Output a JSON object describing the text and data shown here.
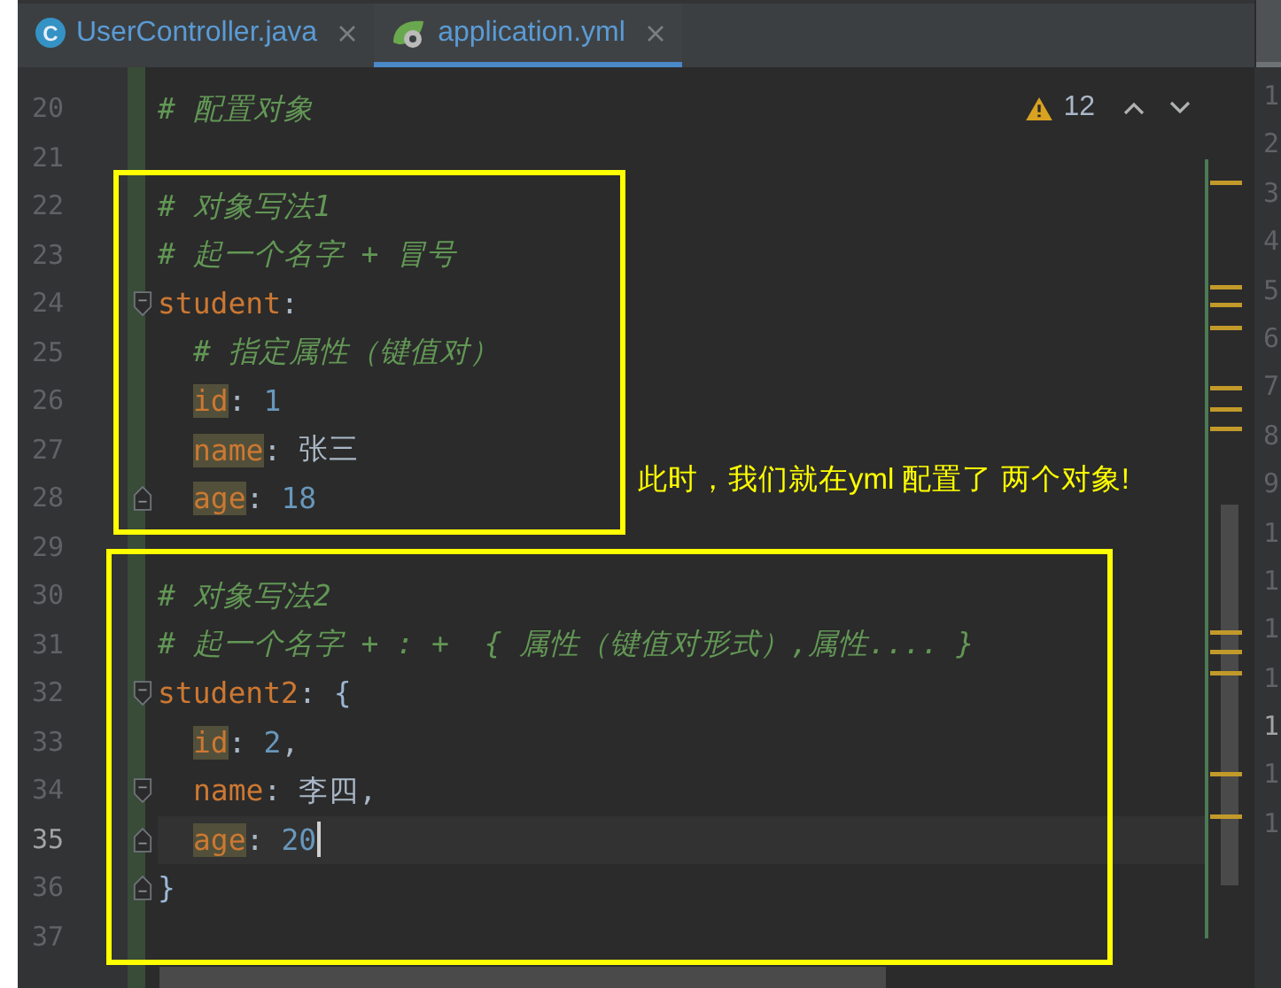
{
  "tabs": [
    {
      "label": "UserController.java",
      "kind": "class",
      "icon_letter": "C",
      "selected": false
    },
    {
      "label": "application.yml",
      "kind": "spring",
      "selected": true
    }
  ],
  "inspections": {
    "warnings": "12"
  },
  "lines": [
    {
      "number": "20",
      "tokens": [
        {
          "kind": "comment",
          "text": "# 配置对象"
        }
      ]
    },
    {
      "number": "21"
    },
    {
      "number": "22",
      "tokens": [
        {
          "kind": "comment",
          "text": "# 对象写法1"
        }
      ]
    },
    {
      "number": "23",
      "tokens": [
        {
          "kind": "comment",
          "text": "# 起一个名字 + 冒号"
        }
      ]
    },
    {
      "number": "24",
      "fold_start": true,
      "tokens": [
        {
          "kind": "key",
          "text": "student",
          "highlighted": false
        },
        {
          "kind": "punct",
          "text": ":"
        }
      ],
      "children": [
        {
          "number": "25",
          "tokens": [
            {
              "kind": "comment",
              "text": "# 指定属性（键值对）"
            }
          ]
        },
        {
          "number": "26",
          "tokens": [
            {
              "kind": "key",
              "text": "id",
              "highlighted": true
            },
            {
              "kind": "punct",
              "text": ": "
            },
            {
              "kind": "number",
              "text": "1"
            }
          ]
        },
        {
          "number": "27",
          "tokens": [
            {
              "kind": "key",
              "text": "name",
              "highlighted": true
            },
            {
              "kind": "punct",
              "text": ": "
            },
            {
              "kind": "value",
              "text": "张三"
            }
          ]
        },
        {
          "number": "28",
          "fold_end": true,
          "tokens": [
            {
              "kind": "key",
              "text": "age",
              "highlighted": true
            },
            {
              "kind": "punct",
              "text": ": "
            },
            {
              "kind": "number",
              "text": "18"
            }
          ]
        }
      ]
    },
    {
      "number": "29"
    },
    {
      "number": "30",
      "tokens": [
        {
          "kind": "comment",
          "text": "# 对象写法2"
        }
      ]
    },
    {
      "number": "31",
      "tokens": [
        {
          "kind": "comment",
          "text": "# 起一个名字 + : +  { 属性（键值对形式）,属性.... }"
        }
      ]
    },
    {
      "number": "32",
      "fold_start": true,
      "tokens": [
        {
          "kind": "key",
          "text": "student2",
          "highlighted": false
        },
        {
          "kind": "punct",
          "text": ": "
        },
        {
          "kind": "brace",
          "text": "{"
        }
      ],
      "children": [
        {
          "number": "33",
          "tokens": [
            {
              "kind": "key",
              "text": "id",
              "highlighted": true
            },
            {
              "kind": "punct",
              "text": ": "
            },
            {
              "kind": "number",
              "text": "2"
            },
            {
              "kind": "punct",
              "text": ","
            }
          ]
        },
        {
          "number": "34",
          "fold_start": true,
          "tokens": [
            {
              "kind": "key",
              "text": "name",
              "highlighted": false
            },
            {
              "kind": "punct",
              "text": ": "
            },
            {
              "kind": "value",
              "text": "李四"
            },
            {
              "kind": "punct",
              "text": ","
            }
          ]
        },
        {
          "number": "35",
          "fold_end": true,
          "current": true,
          "tokens": [
            {
              "kind": "key",
              "text": "age",
              "highlighted": true
            },
            {
              "kind": "punct",
              "text": ": "
            },
            {
              "kind": "number",
              "text": "20"
            }
          ]
        }
      ]
    },
    {
      "number": "36",
      "fold_end": true,
      "tokens": [
        {
          "kind": "brace",
          "text": "}"
        }
      ]
    },
    {
      "number": "37"
    }
  ],
  "note": "此时，我们就在yml 配置了 两个对象!",
  "right_pane": {
    "line_numbers": [
      {
        "text": "1",
        "current": false
      },
      {
        "text": "2",
        "current": false
      },
      {
        "text": "3",
        "current": false
      },
      {
        "text": "4",
        "current": false
      },
      {
        "text": "5",
        "current": false
      },
      {
        "text": "6",
        "current": false
      },
      {
        "text": "7",
        "current": false
      },
      {
        "text": "8",
        "current": false
      },
      {
        "text": "9",
        "current": false
      },
      {
        "text": "1",
        "current": false
      },
      {
        "text": "1",
        "current": false
      },
      {
        "text": "1",
        "current": false
      },
      {
        "text": "1",
        "current": false
      },
      {
        "text": "1",
        "current": true
      },
      {
        "text": "1",
        "current": false
      },
      {
        "text": "1",
        "current": false
      }
    ]
  }
}
